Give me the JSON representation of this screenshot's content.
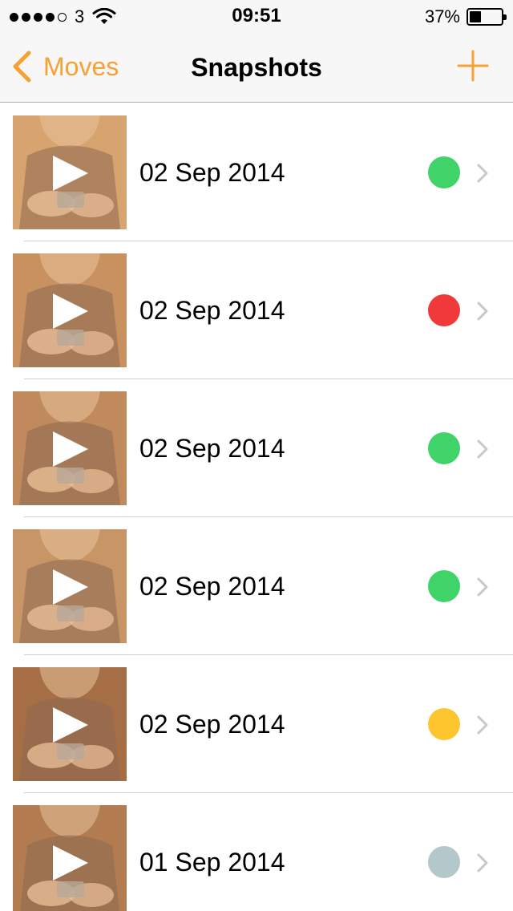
{
  "status_bar": {
    "carrier": "3",
    "time": "09:51",
    "battery_percent": "37%",
    "battery_level": 0.37,
    "signal_bars_filled": 4,
    "signal_bars_total": 5
  },
  "nav": {
    "back_label": "Moves",
    "title": "Snapshots",
    "accent_color": "#f7a034"
  },
  "snapshots": [
    {
      "date": "02 Sep 2014",
      "status_color": "#3fd36a",
      "thumb_tone": "#d7a36e"
    },
    {
      "date": "02 Sep 2014",
      "status_color": "#f0393b",
      "thumb_tone": "#c99160"
    },
    {
      "date": "02 Sep 2014",
      "status_color": "#3fd36a",
      "thumb_tone": "#c08a5c"
    },
    {
      "date": "02 Sep 2014",
      "status_color": "#3fd36a",
      "thumb_tone": "#c89566"
    },
    {
      "date": "02 Sep 2014",
      "status_color": "#fec62e",
      "thumb_tone": "#a56e45"
    },
    {
      "date": "01 Sep 2014",
      "status_color": "#b3c8cb",
      "thumb_tone": "#b27c50"
    }
  ],
  "icons": {
    "back": "chevron-left-icon",
    "add": "plus-icon",
    "play": "play-icon",
    "disclosure": "chevron-right-icon"
  }
}
